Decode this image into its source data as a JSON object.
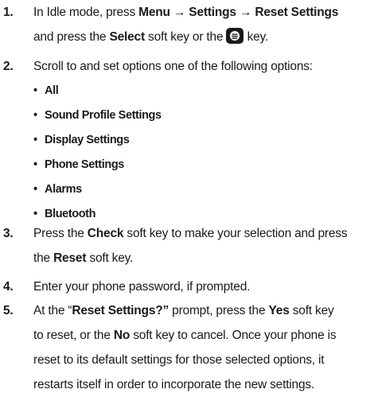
{
  "steps": [
    {
      "number": "1.",
      "parts": [
        "In Idle mode, press ",
        "Menu → Settings → Reset Settings",
        "and press the ",
        "Select",
        " soft key or the ",
        " key."
      ]
    },
    {
      "number": "2.",
      "text": "Scroll to and set options one of the following options:",
      "options": [
        "All",
        "Sound Profile Settings",
        "Display Settings",
        "Phone Settings",
        "Alarms",
        "Bluetooth"
      ]
    },
    {
      "number": "3.",
      "parts": [
        "Press the ",
        "Check",
        " soft key to make your selection and press",
        "the ",
        "Reset",
        " soft key."
      ]
    },
    {
      "number": "4.",
      "text": "Enter your phone password, if prompted."
    },
    {
      "number": "5.",
      "parts": [
        "At the “",
        "Reset Settings?”",
        " prompt, press the ",
        "Yes",
        " soft key",
        "to reset, or the ",
        "No",
        " soft key to cancel. Once your phone is",
        "reset to its default settings for those selected options, it",
        "restarts itself in order to incorporate the new settings."
      ]
    }
  ],
  "icons": {
    "select_key": "menu-ok-key-icon"
  }
}
